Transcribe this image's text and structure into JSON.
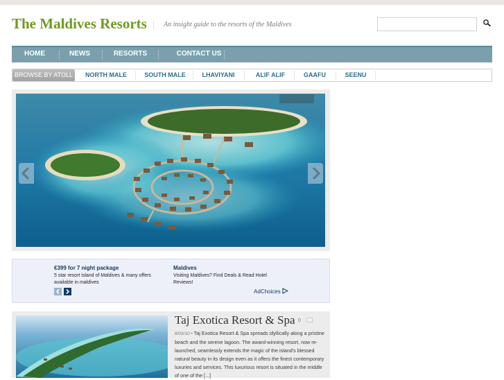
{
  "header": {
    "site_title": "The Maldives Resorts",
    "tagline": "An insight guide to the resorts of the Maldives",
    "search_placeholder": ""
  },
  "main_nav": {
    "items": [
      "HOME",
      "NEWS",
      "RESORTS",
      "CONTACT US"
    ]
  },
  "atoll_nav": {
    "browse_label": "BROWSE BY ATOLL",
    "items": [
      "NORTH MALE",
      "SOUTH MALE",
      "LHAVIYANI",
      "ALIF ALIF",
      "GAAFU",
      "SEENU"
    ]
  },
  "ad": {
    "items": [
      {
        "title": "€399 for 7 night package",
        "text": "5 star resort island of Maldives & many offers available in maldives"
      },
      {
        "title": "Maldives",
        "text": "Visiting Maldives? Find Deals & Read Hotel Reviews!"
      }
    ],
    "adchoices_label": "AdChoices"
  },
  "post": {
    "title": "Taj Exotica Resort & Spa",
    "comments": "0",
    "date": "8/03/10 •",
    "excerpt": "Taj Exotica Resort & Spa spreads idyllically along a pristine beach and the serene lagoon. The award-winning resort, now re-launched, seamlessly extends the magic of the island's blessed natural beauty in its design even as it offers the finest contemporary luxuries and services. This luxurious resort is situated in the middle of one of the [...]"
  },
  "colors": {
    "title_green": "#6f9a1e",
    "nav_blue": "#7aa0ad",
    "atoll_link": "#2d6f8c",
    "ad_bg": "#eef0f9"
  }
}
